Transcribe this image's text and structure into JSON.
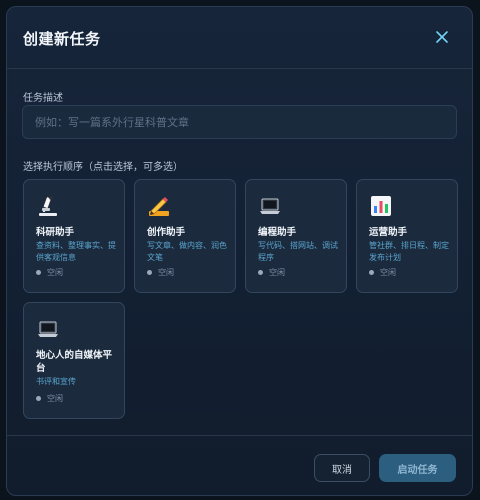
{
  "modal": {
    "title": "创建新任务"
  },
  "description": {
    "label": "任务描述",
    "placeholder": "例如：写一篇系外行星科普文章",
    "value": ""
  },
  "agents_section": {
    "label": "选择执行顺序（点击选择，可多选）",
    "items": [
      {
        "icon": "microscope-icon",
        "name": "科研助手",
        "desc": "查资料、整理事实、提供客观信息",
        "status": "空闲"
      },
      {
        "icon": "pencil-icon",
        "name": "创作助手",
        "desc": "写文章、做内容、润色文笔",
        "status": "空闲"
      },
      {
        "icon": "laptop-icon",
        "name": "编程助手",
        "desc": "写代码、搭网站、调试程序",
        "status": "空闲"
      },
      {
        "icon": "bar-chart-icon",
        "name": "运营助手",
        "desc": "管社群、排日程、制定发布计划",
        "status": "空闲"
      },
      {
        "icon": "laptop-icon",
        "name": "地心人的自媒体平台",
        "desc": "书评和宣传",
        "status": "空闲"
      }
    ]
  },
  "footer": {
    "cancel_label": "取消",
    "start_label": "启动任务"
  },
  "colors": {
    "background": "#0b141d",
    "modal": "#17253a",
    "card": "#1b2a3d",
    "accent_text": "#5aa6cf",
    "primary_button": "#2c5e80"
  }
}
